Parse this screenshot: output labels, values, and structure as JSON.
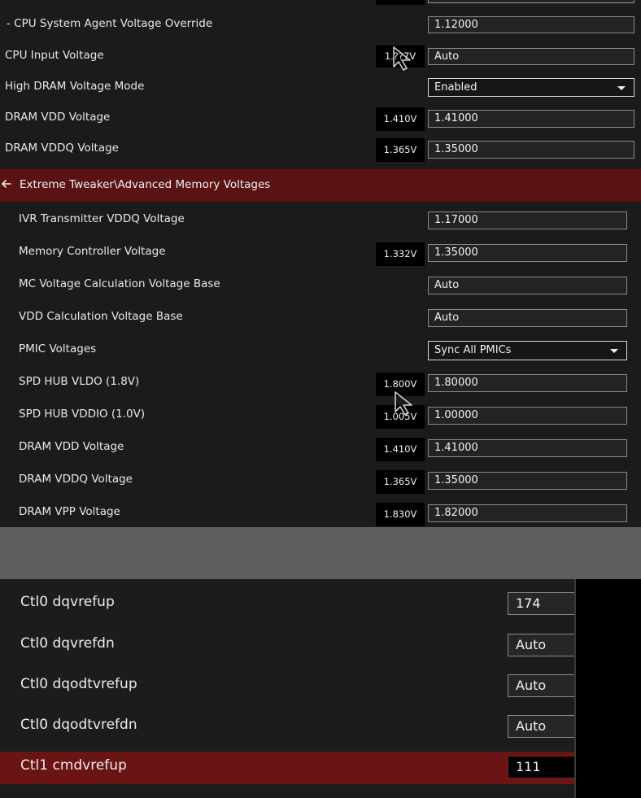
{
  "section1": {
    "rows": [
      {
        "label": "- CPU System Agent Voltage Override",
        "current": "",
        "value": "1.12000",
        "type": "text"
      },
      {
        "label": "CPU Input Voltage",
        "current": "1.??7V",
        "value": "Auto",
        "type": "text"
      },
      {
        "label": "High DRAM Voltage Mode",
        "current": "",
        "value": "Enabled",
        "type": "dropdown"
      },
      {
        "label": "DRAM VDD Voltage",
        "current": "1.410V",
        "value": "1.41000",
        "type": "text"
      },
      {
        "label": "DRAM VDDQ Voltage",
        "current": "1.365V",
        "value": "1.35000",
        "type": "text"
      }
    ]
  },
  "section2": {
    "header_title": "Extreme Tweaker\\Advanced Memory Voltages",
    "rows": [
      {
        "label": "IVR Transmitter VDDQ Voltage",
        "current": "",
        "value": "1.17000",
        "type": "text"
      },
      {
        "label": "Memory Controller Voltage",
        "current": "1.332V",
        "value": "1.35000",
        "type": "text"
      },
      {
        "label": "MC Voltage Calculation Voltage Base",
        "current": "",
        "value": "Auto",
        "type": "text"
      },
      {
        "label": "VDD Calculation Voltage Base",
        "current": "",
        "value": "Auto",
        "type": "text"
      },
      {
        "label": "PMIC Voltages",
        "current": "",
        "value": "Sync All PMICs",
        "type": "dropdown"
      },
      {
        "label": "SPD HUB VLDO (1.8V)",
        "current": "1.800V",
        "value": "1.80000",
        "type": "text"
      },
      {
        "label": "SPD HUB VDDIO (1.0V)",
        "current": "1.005V",
        "value": "1.00000",
        "type": "text"
      },
      {
        "label": "DRAM VDD Voltage",
        "current": "1.410V",
        "value": "1.41000",
        "type": "text"
      },
      {
        "label": "DRAM VDDQ Voltage",
        "current": "1.365V",
        "value": "1.35000",
        "type": "text"
      },
      {
        "label": "DRAM VPP Voltage",
        "current": "1.830V",
        "value": "1.82000",
        "type": "text"
      }
    ]
  },
  "section3": {
    "rows": [
      {
        "label": "Ctl0 dqvrefup",
        "value": "174",
        "selected": false
      },
      {
        "label": "Ctl0 dqvrefdn",
        "value": "Auto",
        "selected": false
      },
      {
        "label": "Ctl0 dqodtvrefup",
        "value": "Auto",
        "selected": false
      },
      {
        "label": "Ctl0 dqodtvrefdn",
        "value": "Auto",
        "selected": false
      },
      {
        "label": "Ctl1 cmdvrefup",
        "value": "111",
        "selected": true
      }
    ]
  },
  "icons": {
    "back": "back-arrow-icon",
    "cursor": "mouse-cursor-icon",
    "dropdown": "chevron-down-icon"
  },
  "colors": {
    "header_bg": "#5a1212",
    "selected_row_bg": "#6a1414",
    "panel_bg": "#1b1b1b",
    "gap_bg": "#5e5e5e"
  }
}
